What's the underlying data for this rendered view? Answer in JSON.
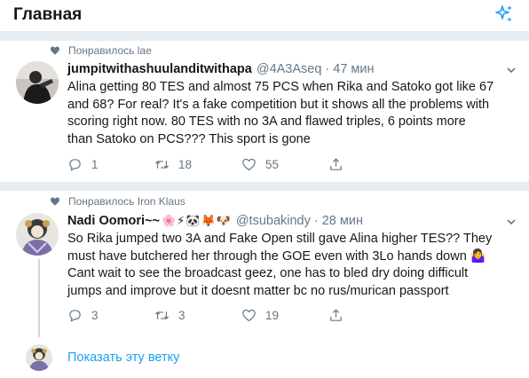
{
  "header": {
    "title": "Главная"
  },
  "tweets": [
    {
      "social_context": "Понравилось lae",
      "display_name": "jumpitwithashuulanditwithapa",
      "handle": "@4A3Aseq",
      "separator": "·",
      "time": "47 мин",
      "text_lines": [
        "Alina getting 80 TES and almost 75 PCS when Rika and Satoko got like 67",
        "and 68? For real? It's a fake competition but it shows all the problems with",
        "scoring right now. 80 TES with no 3A and flawed triples, 6 points more",
        "than Satoko on PCS??? This sport is gone"
      ],
      "replies": "1",
      "retweets": "18",
      "likes": "55"
    },
    {
      "social_context": "Понравилось Iron Klaus",
      "display_name": "Nadi Oomori~~",
      "name_emoji": "🌸⚡🐼🦊🐶",
      "handle": "@tsubakindy",
      "separator": "·",
      "time": "28 мин",
      "text_lines": [
        "So Rika jumped two 3A and Fake Open still gave Alina higher TES?? They",
        "must have butchered her through the GOE even with 3Lo hands down 🤷‍♀️",
        " Cant wait to see the broadcast geez, one has to bled dry doing difficult",
        "jumps and improve but it doesnt matter bc no rus/murican passport"
      ],
      "replies": "3",
      "retweets": "3",
      "likes": "19"
    }
  ],
  "show_thread": "Показать эту ветку",
  "colors": {
    "accent": "#1da1f2",
    "secondary_text": "#657786",
    "divider": "#e6ecf0"
  }
}
